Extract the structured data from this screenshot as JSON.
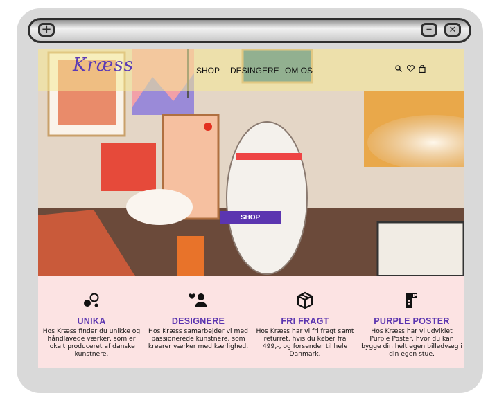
{
  "site": {
    "logo": "Kræss",
    "nav": [
      "SHOP",
      "DESINGERE",
      "OM OS"
    ],
    "icons": [
      "search-icon",
      "heart-icon",
      "bag-icon"
    ],
    "hero_button": "SHOP"
  },
  "window": {
    "add_glyph": "+",
    "minimize_glyph": "–",
    "close_glyph": "✕"
  },
  "features": [
    {
      "icon": "circles-icon",
      "title": "UNIKA",
      "text": "Hos Kræss finder du unikke og håndlavede værker, som er lokalt produceret af danske kunstnere."
    },
    {
      "icon": "user-heart-icon",
      "title": "DESIGNERE",
      "text": "Hos Kræss samarbejder vi med passionerede kunstnere, som kreerer værker med kærlighed."
    },
    {
      "icon": "box-icon",
      "title": "FRI FRAGT",
      "text": "Hos Kræss har vi fri fragt samt returret, hvis du køber fra 499,-, og forsender til hele Danmark."
    },
    {
      "icon": "ruler-icon",
      "title": "PURPLE POSTER",
      "text": "Hos Kræss har vi udviklet Purple Poster, hvor du kan bygge din helt egen billedvæg i din egen stue."
    }
  ],
  "colors": {
    "accent": "#5b35b0",
    "nav_tint": "#f4e996",
    "feature_bg": "#fce3e3"
  }
}
